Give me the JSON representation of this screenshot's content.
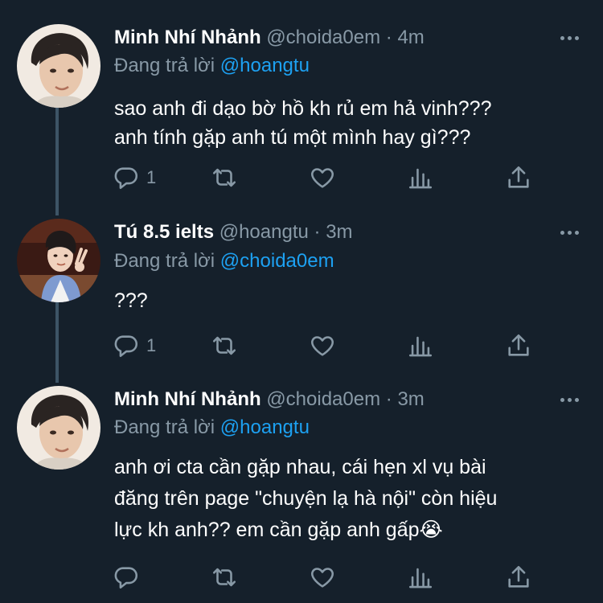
{
  "tweets": [
    {
      "name": "Minh Nhí Nhảnh",
      "handle": "@choida0em",
      "dot": "·",
      "time": "4m",
      "replying_prefix": "Đang trả lời",
      "replying_to": "@hoangtu",
      "lines": [
        "sao anh đi dạo bờ hồ kh rủ em hả vinh???",
        "anh tính gặp anh tú một mình hay gì???"
      ],
      "reply_count": "1"
    },
    {
      "name": "Tú 8.5 ielts",
      "handle": "@hoangtu",
      "dot": "·",
      "time": "3m",
      "replying_prefix": "Đang trả lời",
      "replying_to": "@choida0em",
      "lines": [
        "???"
      ],
      "reply_count": "1"
    },
    {
      "name": "Minh Nhí Nhảnh",
      "handle": "@choida0em",
      "dot": "·",
      "time": "3m",
      "replying_prefix": "Đang trả lời",
      "replying_to": "@hoangtu",
      "lines": [
        "anh ơi cta cần gặp nhau, cái hẹn xl vụ bài",
        "đăng trên page \"chuyện lạ hà nội\" còn hiệu",
        "lực kh anh?? em cần gặp anh gấp😭"
      ],
      "reply_count": ""
    }
  ],
  "icons": {
    "reply": "reply-icon",
    "retweet": "retweet-icon",
    "like": "heart-icon",
    "analytics": "analytics-icon",
    "share": "share-icon",
    "more": "more-icon"
  },
  "colors": {
    "background": "#15202b",
    "text": "#ffffff",
    "secondary": "#8899a6",
    "link": "#1da1f2",
    "thread_line": "#3d5466"
  }
}
